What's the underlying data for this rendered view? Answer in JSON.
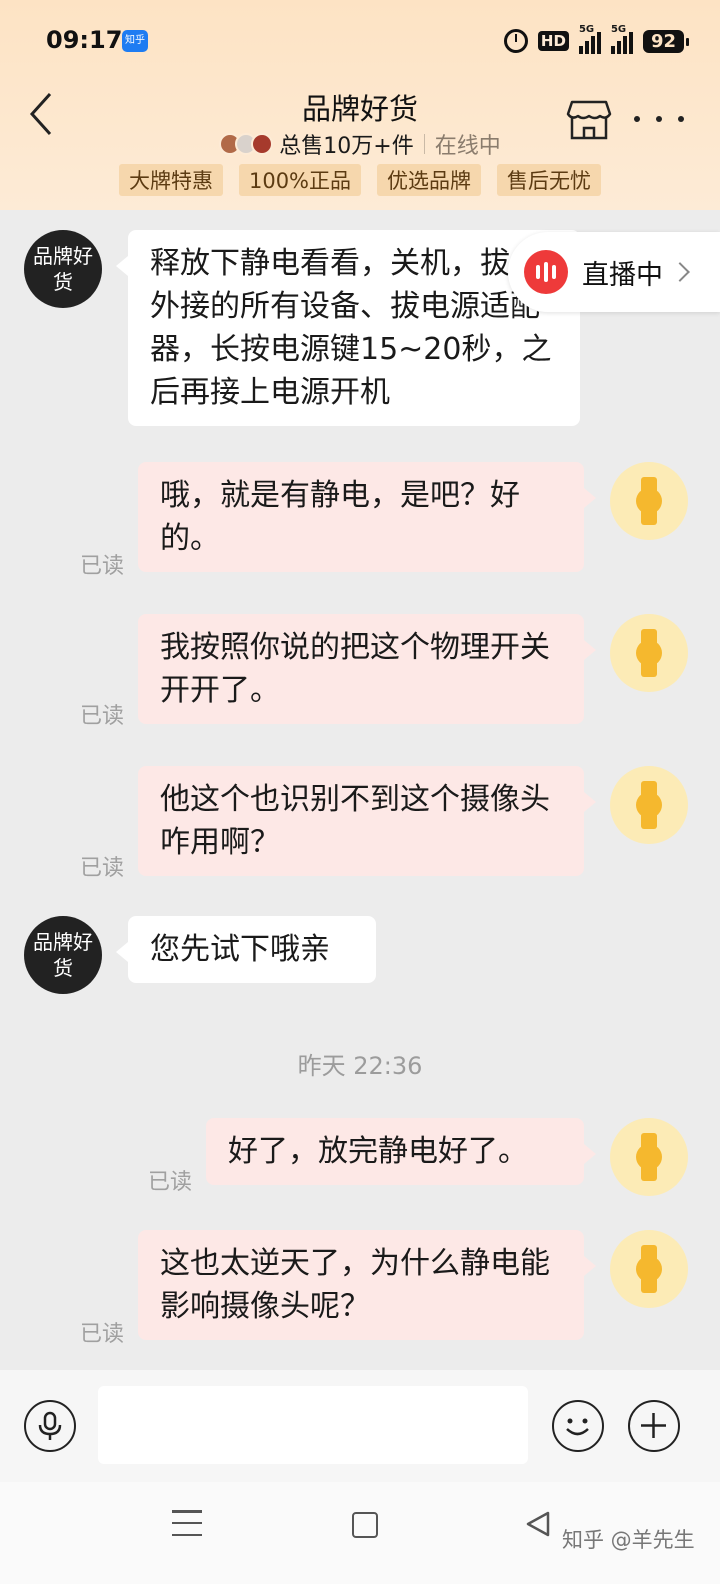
{
  "status_bar": {
    "time": "09:17",
    "app_badge": "知乎",
    "hd": "HD",
    "signal1_label": "5G",
    "signal2_label": "5G",
    "battery": "92"
  },
  "header": {
    "title": "品牌好货",
    "sales": "总售10万+件",
    "online": "在线中",
    "tags": [
      "大牌特惠",
      "100%正品",
      "优选品牌",
      "售后无忧"
    ]
  },
  "shop_avatar_text": "品牌好货",
  "live": {
    "label": "直播中"
  },
  "messages": [
    {
      "from": "shop",
      "text": "释放下静电看看，关机，拔出外接的所有设备、拔电源适配器，长按电源键15~20秒，之后再接上电源开机"
    },
    {
      "from": "me",
      "text": "哦，就是有静电，是吧？好的。",
      "status": "已读"
    },
    {
      "from": "me",
      "text": "我按照你说的把这个物理开关开开了。",
      "status": "已读"
    },
    {
      "from": "me",
      "text": "他这个也识别不到这个摄像头咋用啊？",
      "status": "已读"
    },
    {
      "from": "shop",
      "text": "您先试下哦亲"
    },
    {
      "from": "me",
      "text": "好了，放完静电好了。",
      "status": "已读"
    },
    {
      "from": "me",
      "text": "这也太逆天了，为什么静电能影响摄像头呢？",
      "status": "已读"
    }
  ],
  "timestamp": "昨天 22:36",
  "input": {
    "placeholder": ""
  },
  "watermark": "知乎 @羊先生",
  "colors": {
    "header_bg": "#fde3c4",
    "tag_bg": "#f6d7ad",
    "out_bubble": "#fde8e6",
    "live_red": "#ee3a3a",
    "user_avatar": "#fcebb6",
    "watch_icon": "#f5b82e"
  }
}
